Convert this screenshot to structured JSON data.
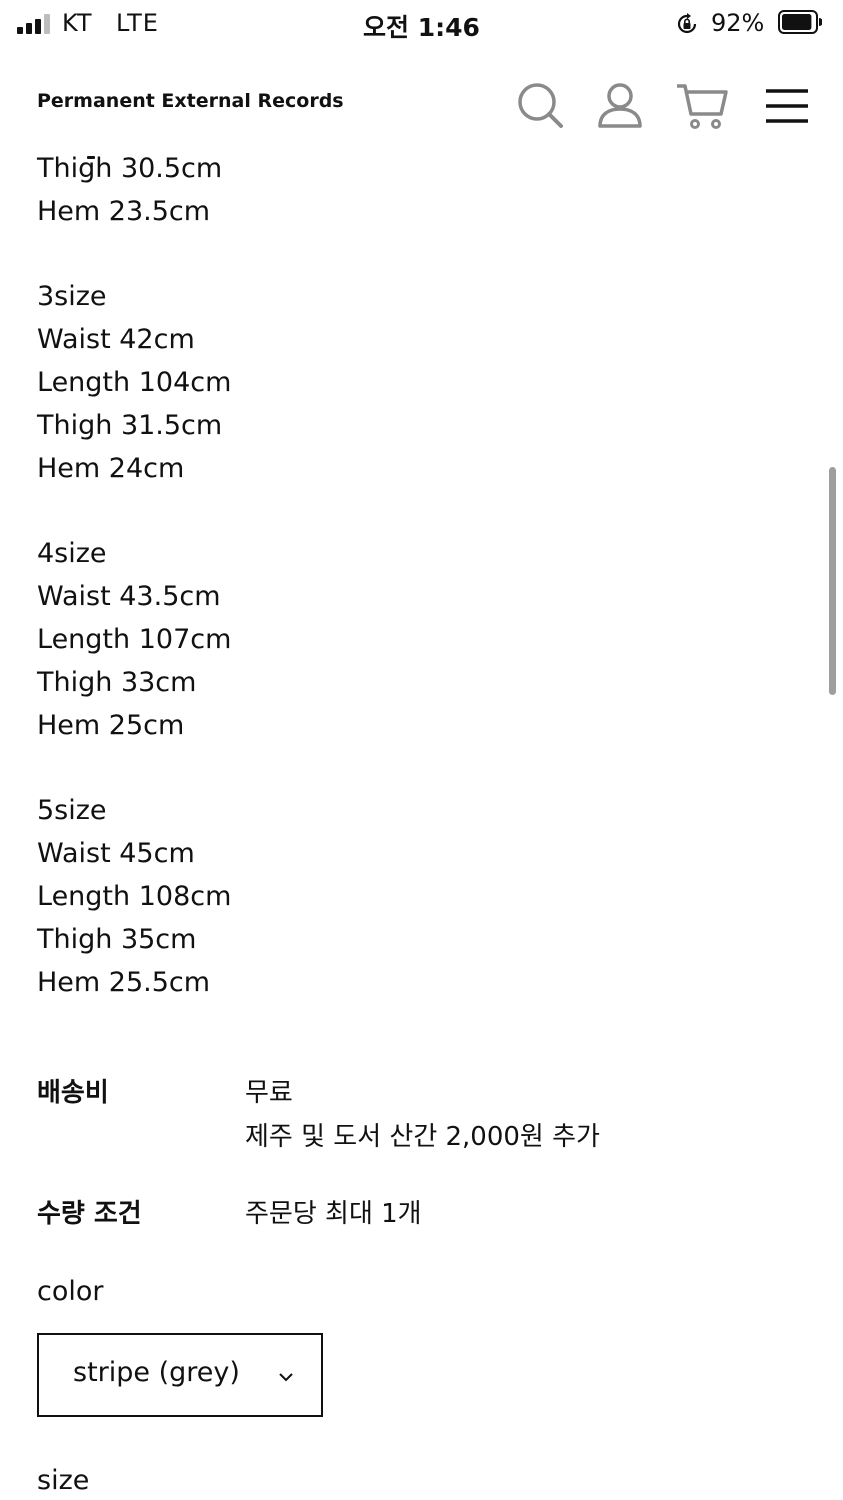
{
  "status_bar": {
    "carrier": "KT",
    "network": "LTE",
    "time": "오전 1:46",
    "battery_percent": "92%",
    "signal_bars_active": 3,
    "signal_bars_total": 4,
    "battery_level": 0.92
  },
  "header": {
    "brand": "Permanent External Records",
    "icons": [
      "search-icon",
      "user-icon",
      "cart-icon",
      "menu-icon"
    ]
  },
  "size_chart": {
    "partial_top": [
      "Thigh 30.5cm",
      "Hem 23.5cm"
    ],
    "blocks": [
      {
        "title": "3size",
        "lines": [
          "Waist 42cm",
          "Length 104cm",
          "Thigh 31.5cm",
          "Hem 24cm"
        ]
      },
      {
        "title": "4size",
        "lines": [
          "Waist 43.5cm",
          "Length 107cm",
          "Thigh 33cm",
          "Hem 25cm"
        ]
      },
      {
        "title": "5size",
        "lines": [
          "Waist 45cm",
          "Length 108cm",
          "Thigh 35cm",
          "Hem 25.5cm"
        ]
      }
    ]
  },
  "shipping": {
    "label": "배송비",
    "value": "무료",
    "note": "제주 및 도서 산간 2,000원 추가"
  },
  "quantity": {
    "label": "수량 조건",
    "value": "주문당 최대 1개"
  },
  "options": {
    "color_label": "color",
    "color_selected": "stripe (grey)",
    "size_label": "size"
  },
  "colors": {
    "text": "#111111",
    "icon_gray": "#8a8a8a",
    "scrollbar": "#9e9e9e"
  }
}
